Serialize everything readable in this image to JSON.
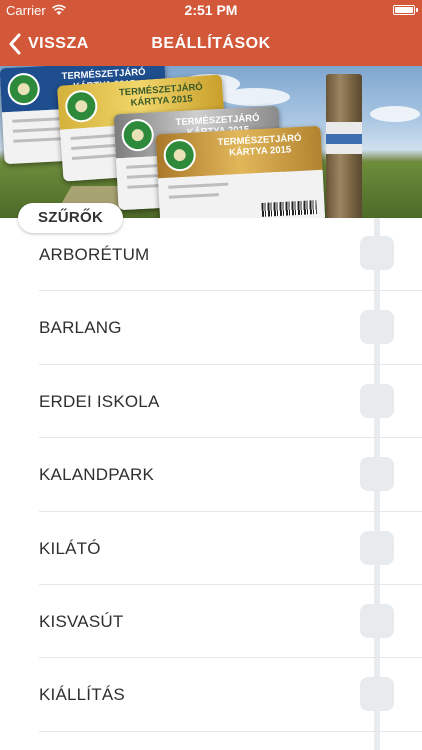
{
  "status_bar": {
    "carrier": "Carrier",
    "time": "2:51 PM",
    "wifi_icon": "wifi-icon",
    "battery_icon": "battery-icon"
  },
  "nav": {
    "back_label": "VISSZA",
    "back_icon": "chevron-left-icon",
    "title": "BEÁLLÍTÁSOK",
    "background_color": "#d3583a"
  },
  "hero": {
    "cards": [
      {
        "title": "TERMÉSZETJÁRÓ KÁRTYA 2015",
        "color": "#1f4e8f"
      },
      {
        "title": "TERMÉSZETJÁRÓ KÁRTYA 2015",
        "color": "#f1d66a"
      },
      {
        "title": "TERMÉSZETJÁRÓ KÁRTYA 2015",
        "color": "#cfcfcf"
      },
      {
        "title": "TERMÉSZETJÁRÓ KÁRTYA 2015",
        "color": "#e2b75a"
      }
    ]
  },
  "filters": {
    "label": "SZŰRŐK",
    "items": [
      {
        "label": "ARBORÉTUM",
        "enabled": false
      },
      {
        "label": "BARLANG",
        "enabled": false
      },
      {
        "label": "ERDEI ISKOLA",
        "enabled": false
      },
      {
        "label": "KALANDPARK",
        "enabled": false
      },
      {
        "label": "KILÁTÓ",
        "enabled": false
      },
      {
        "label": "KISVASÚT",
        "enabled": false
      },
      {
        "label": "KIÁLLÍTÁS",
        "enabled": false
      }
    ]
  }
}
